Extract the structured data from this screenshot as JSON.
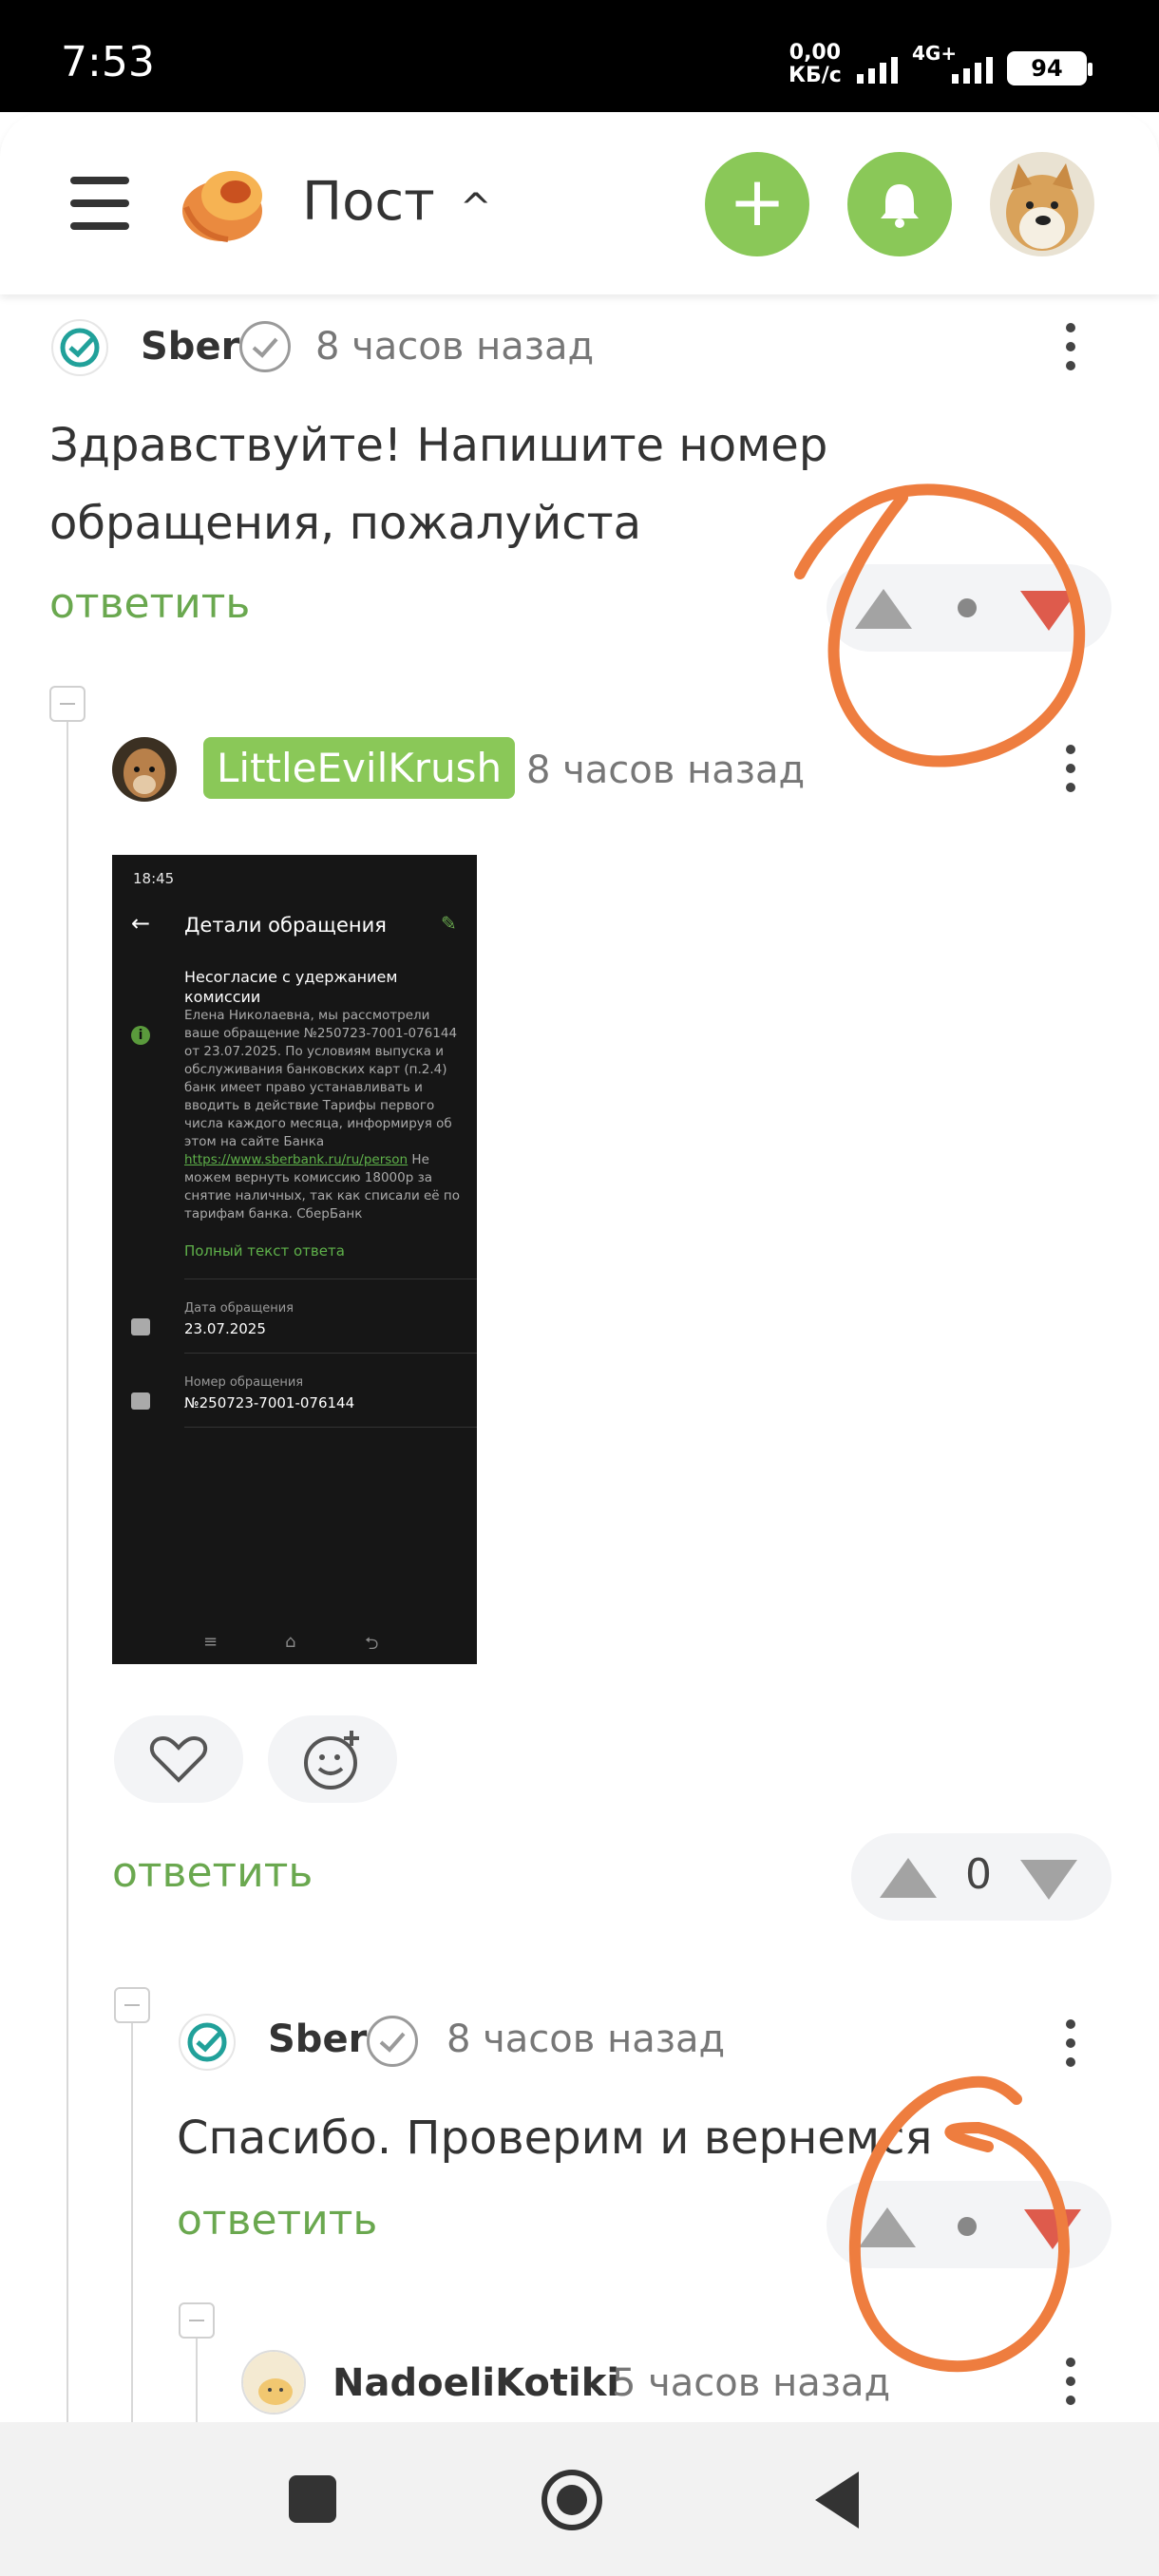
{
  "status_bar": {
    "time": "7:53",
    "speed_value": "0,00",
    "speed_unit": "КБ/с",
    "network": "4G+",
    "battery": "94"
  },
  "header": {
    "title": "Пост",
    "title_chevron": "^",
    "add_button": "+",
    "menu_icon": "hamburger-icon",
    "bell_icon": "bell-icon",
    "accent_color": "#8ac858"
  },
  "comments": [
    {
      "author": "Sber",
      "time": "8 часов назад",
      "text": "Здравствуйте! Напишите номер обращения, пожалуйста",
      "reply_label": "ответить"
    },
    {
      "author": "LittleEvilKrush",
      "time": "8 часов назад",
      "reply_label": "ответить",
      "vote_count": "0",
      "embedded_screenshot": {
        "time": "18:45",
        "title": "Детали обращения",
        "heading": "Несогласие с удержанием комиссии",
        "body_before_link": "Елена Николаевна, мы рассмотрели ваше обращение №250723-7001-076144 от 23.07.2025. По условиям выпуска и обслуживания банковских карт (п.2.4) банк имеет право устанавливать и вводить в действие Тарифы первого числа каждого месяца, информируя об этом на сайте Банка",
        "link": "https://www.sberbank.ru/ru/person",
        "body_after_link": "Не можем вернуть комиссию 18000р за снятие наличных, так как списали её по тарифам банка. СберБанк",
        "full_answer": "Полный текст ответа",
        "date_label": "Дата обращения",
        "date_value": "23.07.2025",
        "number_label": "Номер обращения",
        "number_value": "№250723-7001-076144"
      }
    },
    {
      "author": "Sber",
      "time": "8 часов назад",
      "text": "Спасибо. Проверим и вернемся",
      "reply_label": "ответить"
    },
    {
      "author": "NadoeliKotiki",
      "time": "5 часов назад"
    }
  ],
  "colors": {
    "link_green": "#6aa84f",
    "downvote_red": "#de5b4c",
    "annotation_orange": "#ee7d3f"
  }
}
